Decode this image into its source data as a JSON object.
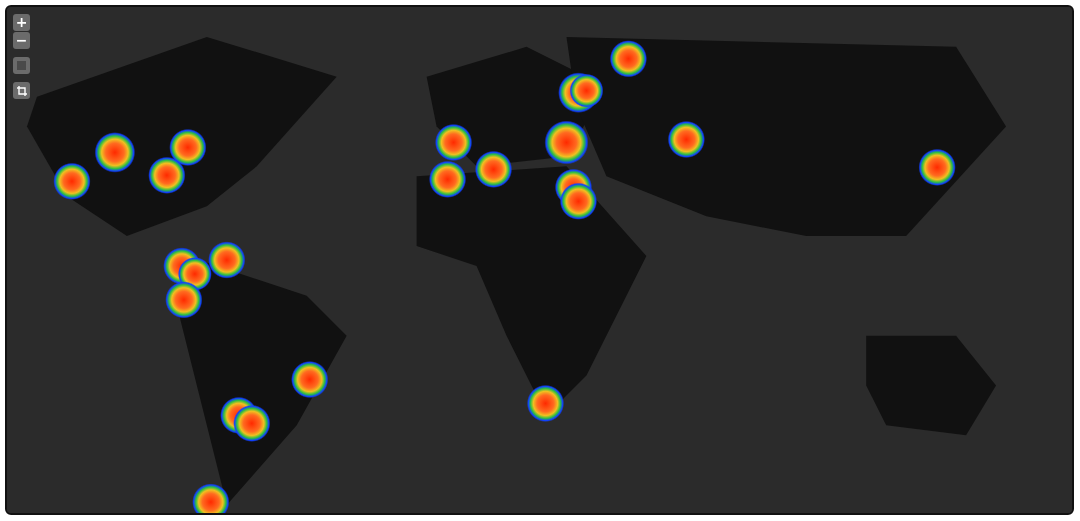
{
  "map": {
    "zoom_controls": {
      "zoom_in": "+",
      "zoom_out": "−"
    },
    "tools": [
      {
        "kind": "square"
      },
      {
        "kind": "crop"
      }
    ]
  }
}
